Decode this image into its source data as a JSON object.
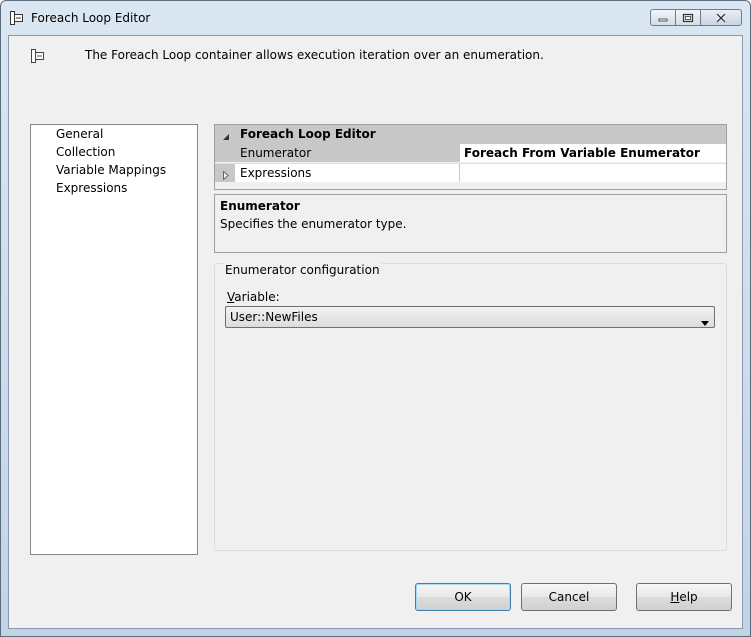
{
  "window": {
    "title": "Foreach Loop Editor",
    "caption_buttons": [
      "minimize-icon",
      "restore-icon",
      "close-icon"
    ]
  },
  "header": {
    "icon": "foreach-loop-icon",
    "description": "The Foreach Loop container allows execution iteration over an enumeration."
  },
  "nav": {
    "items": [
      {
        "label": "General",
        "selected": false
      },
      {
        "label": "Collection",
        "selected": true
      },
      {
        "label": "Variable Mappings",
        "selected": false
      },
      {
        "label": "Expressions",
        "selected": false
      }
    ]
  },
  "property_grid": {
    "category": "Foreach Loop Editor",
    "rows": [
      {
        "name": "Enumerator",
        "value": "Foreach From Variable Enumerator"
      },
      {
        "name": "Expressions",
        "value": ""
      }
    ]
  },
  "help": {
    "title": "Enumerator",
    "text": "Specifies the enumerator type."
  },
  "config": {
    "legend": "Enumerator configuration",
    "variable_label_accel": "V",
    "variable_label_rest": "ariable:",
    "variable_value": "User::NewFiles"
  },
  "buttons": {
    "ok": "OK",
    "cancel": "Cancel",
    "help_accel": "H",
    "help_rest": "elp"
  },
  "colors": {
    "title_gradient_top": "#dbe6f3",
    "client_bg": "#f0f0f0",
    "grid_category_bg": "#c8c8c8"
  }
}
